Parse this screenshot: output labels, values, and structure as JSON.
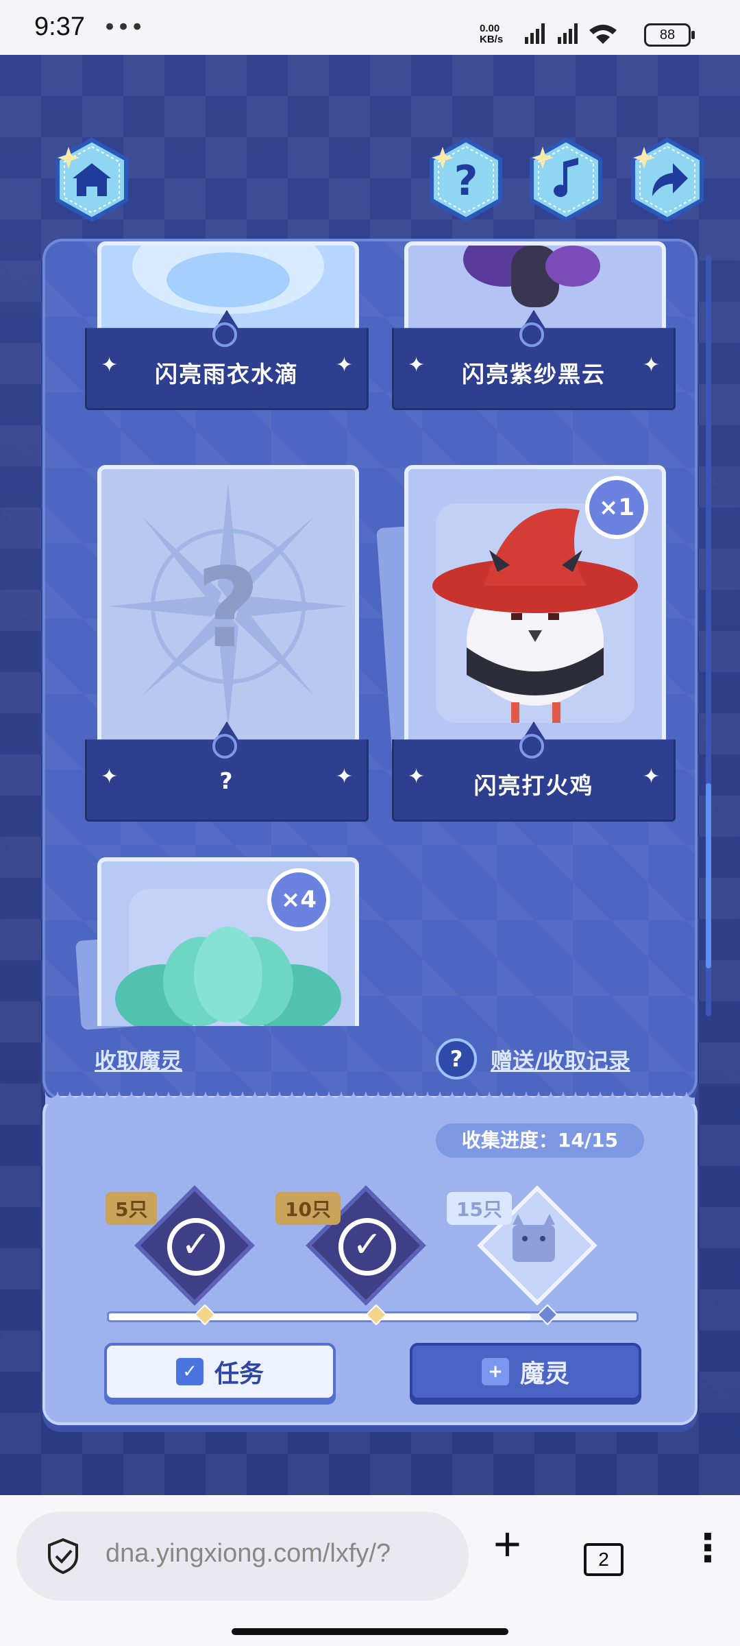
{
  "status_bar": {
    "time": "9:37",
    "dots": "•••",
    "net_speed_value": "0.00",
    "net_speed_unit": "KB/s",
    "battery": "88"
  },
  "top_buttons": [
    {
      "name": "home",
      "icon": "home-icon"
    },
    {
      "name": "help",
      "icon": "question-icon"
    },
    {
      "name": "music",
      "icon": "music-note-icon"
    },
    {
      "name": "share",
      "icon": "share-arrow-icon"
    }
  ],
  "cards": [
    {
      "name": "闪亮雨衣水滴",
      "badge": ""
    },
    {
      "name": "闪亮紫纱黑云",
      "badge": ""
    },
    {
      "name": "?",
      "badge": ""
    },
    {
      "name": "闪亮打火鸡",
      "badge": "×1"
    },
    {
      "name": "",
      "badge": "×4"
    }
  ],
  "links": {
    "collect": "收取魔灵",
    "history": "赠送/收取记录",
    "help_glyph": "?"
  },
  "progress": {
    "label": "收集进度：",
    "value": "14/15",
    "fill_fraction": 0.8,
    "milestones": [
      {
        "tag": "5只",
        "done": true
      },
      {
        "tag": "10只",
        "done": true
      },
      {
        "tag": "15只",
        "done": false
      }
    ],
    "check_glyph": "✓"
  },
  "buttons": {
    "task": "任务",
    "spirit": "魔灵"
  },
  "browser": {
    "url": "dna.yingxiong.com/lxfy/?",
    "plus": "+",
    "tab_count": "2",
    "more": "⋮"
  },
  "colors": {
    "panel": "#4d66c2",
    "accent": "#6c82e0",
    "card_pocket": "#2e3f8f"
  }
}
